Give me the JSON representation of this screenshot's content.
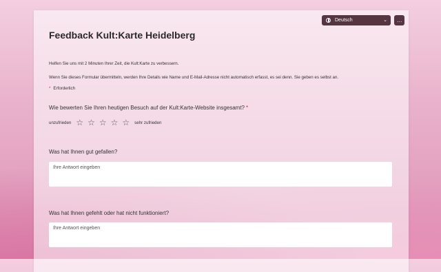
{
  "header": {
    "language_label": "Deutsch",
    "more_label": "…"
  },
  "form": {
    "title": "Feedback Kult:Karte Heidelberg",
    "intro_1": "Helfen Sie uns mit 2 Minuten Ihrer Zeit, die Kult:Karte zu verbessern.",
    "intro_2": "Wenn Sie dieses Formular übermitteln, werden Ihre Details wie Name und E-Mail-Adresse nicht automatisch erfasst, es sei denn. Sie geben es selbst an.",
    "required_note": "Erforderlich",
    "required_mark": "*"
  },
  "questions": [
    {
      "text": "Wie bewerten Sie Ihren heutigen Besuch auf der Kult:Karte-Website insgesamt?",
      "required": true,
      "rating": {
        "min_label": "unzufrieden",
        "max_label": "sehr zufrieden",
        "stars": 5
      }
    },
    {
      "text": "Was hat Ihnen gut gefallen?",
      "placeholder": "Ihre Antwort eingeben"
    },
    {
      "text": "Was hat Ihnen gefehlt oder hat nicht funktioniert?",
      "placeholder": "Ihre Antwort eingeben"
    }
  ],
  "icons": {
    "language": "globe-icon",
    "dropdown": "chevron-down-icon",
    "more": "more-icon",
    "rating": "star-outline-icon"
  },
  "colors": {
    "required": "#c4314b",
    "control_bg": "#55353f"
  }
}
